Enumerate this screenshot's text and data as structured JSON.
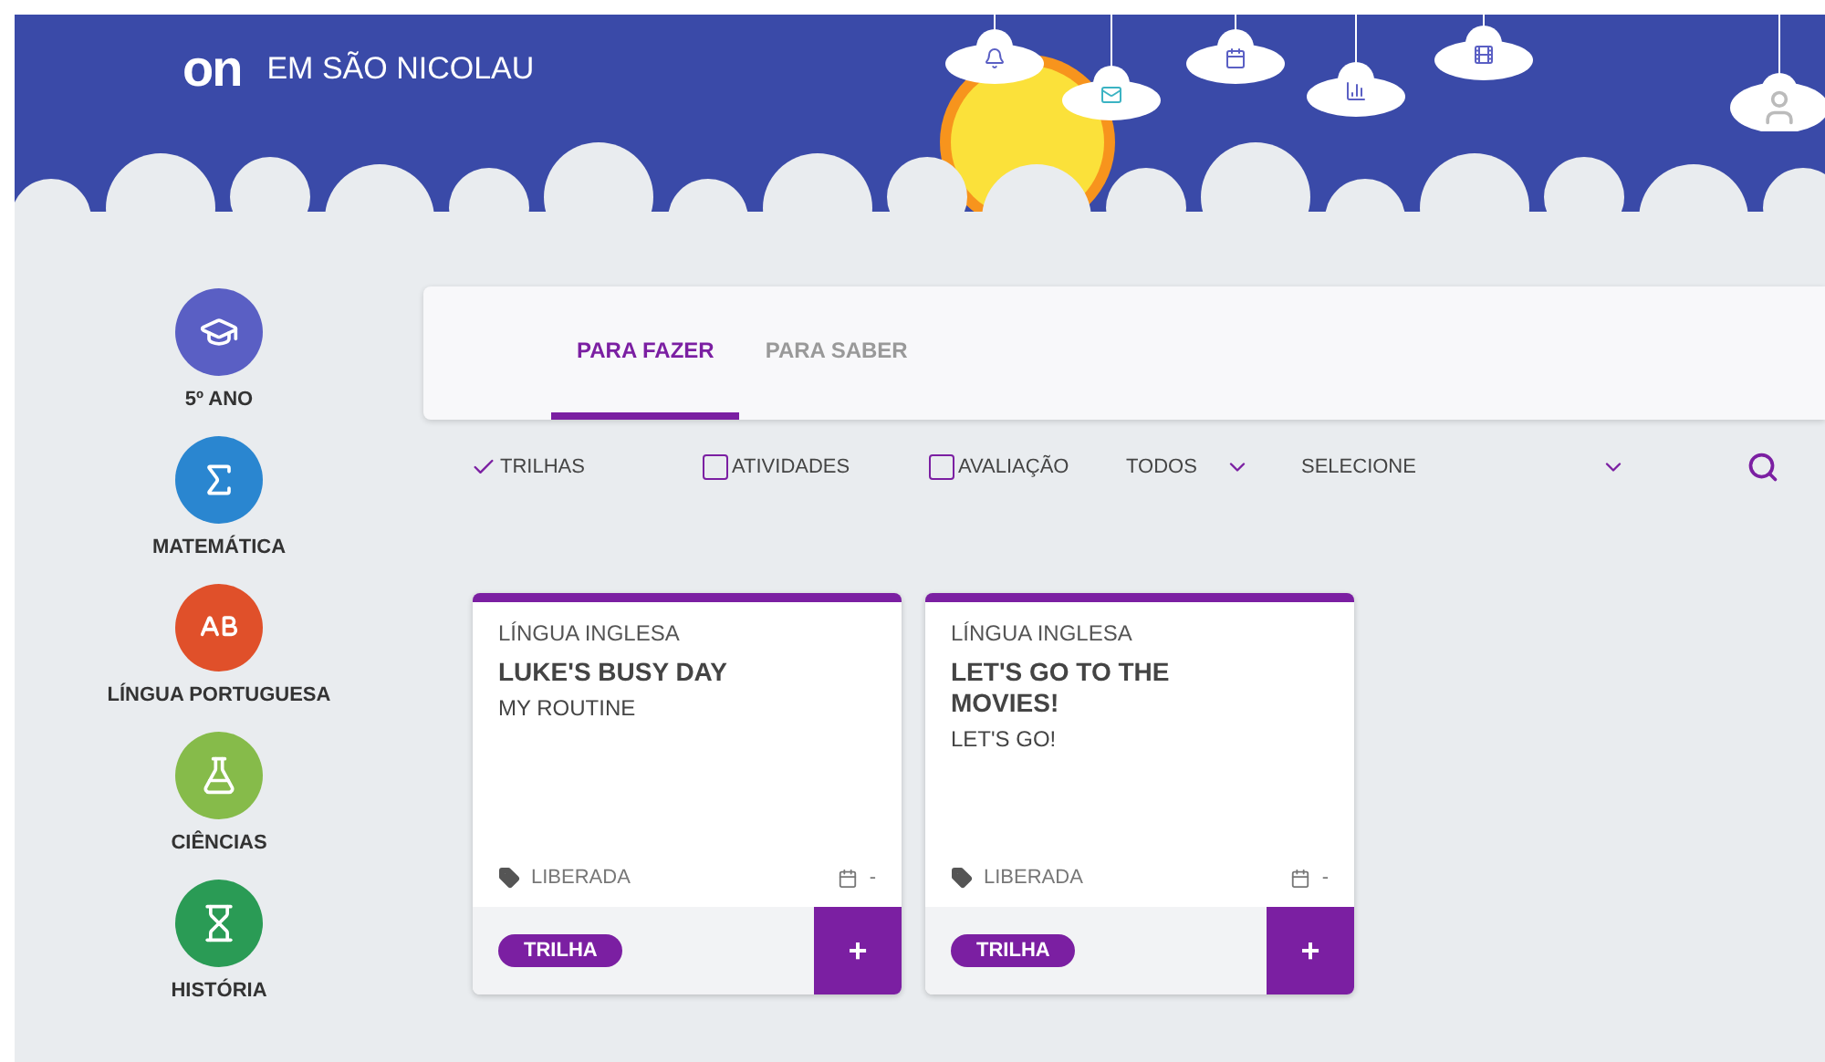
{
  "header": {
    "title": "EM SÃO NICOLAU",
    "logo": "on",
    "icons": [
      {
        "kind": "bell"
      },
      {
        "kind": "mail"
      },
      {
        "kind": "calendar"
      },
      {
        "kind": "chart"
      },
      {
        "kind": "film"
      },
      {
        "kind": "avatar"
      }
    ]
  },
  "sidebar": {
    "items": [
      {
        "label": "5º ANO",
        "kind": "grade",
        "color": "#5a5fc4"
      },
      {
        "label": "MATEMÁTICA",
        "kind": "math",
        "color": "#2a86d0"
      },
      {
        "label": "LÍNGUA PORTUGUESA",
        "kind": "letters",
        "color": "#e0502a"
      },
      {
        "label": "CIÊNCIAS",
        "kind": "science",
        "color": "#86bb4a"
      },
      {
        "label": "HISTÓRIA",
        "kind": "history",
        "color": "#2a9b55"
      }
    ]
  },
  "tabs": [
    {
      "label": "PARA FAZER",
      "selected": true
    },
    {
      "label": "PARA SABER",
      "selected": false
    }
  ],
  "filters": [
    {
      "kind": "check",
      "label": "TRILHAS",
      "checked": true
    },
    {
      "kind": "check",
      "label": "ATIVIDADES",
      "checked": false
    },
    {
      "kind": "check",
      "label": "AVALIAÇÃO",
      "checked": false
    },
    {
      "kind": "select",
      "label": "TODOS"
    },
    {
      "kind": "select",
      "label": "SELECIONE"
    }
  ],
  "cards": [
    {
      "subject": "LÍNGUA INGLESA",
      "title": "LUKE'S BUSY DAY",
      "subtitle": "MY ROUTINE",
      "status": "LIBERADA",
      "date": "-",
      "tag": "TRILHA",
      "action": "+"
    },
    {
      "subject": "LÍNGUA INGLESA",
      "title": "LET'S GO TO THE MOVIES!",
      "subtitle": "LET'S GO!",
      "status": "LIBERADA",
      "date": "-",
      "tag": "TRILHA",
      "action": "+"
    }
  ]
}
